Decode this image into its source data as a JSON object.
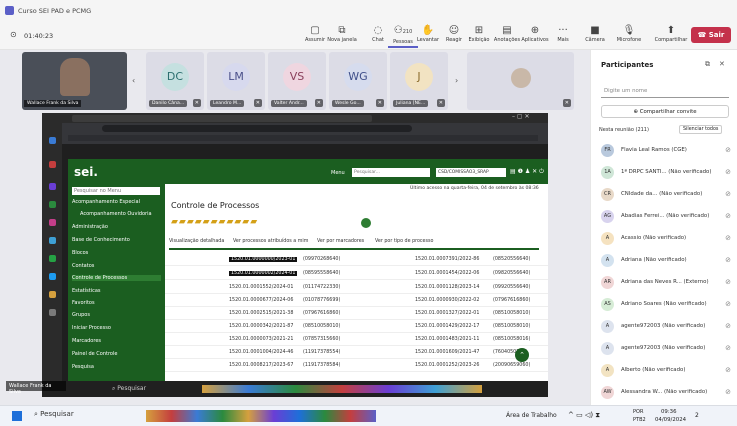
{
  "window": {
    "title": "Curso SEI PAD e PCMG",
    "time": "01:40:23"
  },
  "toolbar": {
    "items": [
      {
        "label": "Assumir",
        "icon": "pen-icon"
      },
      {
        "label": "Nova janela",
        "icon": "window-icon"
      },
      {
        "label": "Chat",
        "icon": "chat-icon"
      },
      {
        "label": "Pessoas",
        "icon": "people-icon",
        "count": "210"
      },
      {
        "label": "Levantar",
        "icon": "hand-icon"
      },
      {
        "label": "Reagir",
        "icon": "smile-icon"
      },
      {
        "label": "Exibição",
        "icon": "grid-icon"
      },
      {
        "label": "Anotações",
        "icon": "notes-icon"
      },
      {
        "label": "Aplicativos",
        "icon": "plus-icon"
      },
      {
        "label": "Mais",
        "icon": "more-icon"
      }
    ],
    "camera": "Câmera",
    "mic": "Microfone",
    "share": "Compartilhar",
    "leave": "Sair"
  },
  "participants_strip": {
    "self_name": "Wallace Frank da Silva",
    "tiles": [
      {
        "initials": "DC",
        "name": "Danilo Câna...",
        "color": "#c5e0e0"
      },
      {
        "initials": "LM",
        "name": "Leandro M...",
        "color": "#d7d9ee"
      },
      {
        "initials": "VS",
        "name": "Valter Andr...",
        "color": "#efd6e0"
      },
      {
        "initials": "WG",
        "name": "Wesle Go...",
        "color": "#d6dcee"
      },
      {
        "initials": "J",
        "name": "Juliana [NE...",
        "color": "#f2e3c2"
      }
    ]
  },
  "sei": {
    "logo": "sei.",
    "menu": "Menu",
    "search_placeholder": "Pesquisar...",
    "unit": "CSD/COMISSÃO3_SRAP",
    "last_access": "Último acesso na quarta-feira, 04 de setembro às 08:36",
    "title": "Controle de Processos",
    "links": [
      "Visualização detalhada",
      "Ver processos atribuídos a mim",
      "Ver por marcadores",
      "Ver por tipo de processo"
    ],
    "left_menu": [
      "Pesquisar no Menu",
      "Acompanhamento Especial",
      "Acompanhamento Ouvidoria",
      "Administração",
      "Base de Conhecimento",
      "Blocos",
      "Contatos",
      "Controle de Processos",
      "Estatísticas",
      "Favoritos",
      "Grupos",
      "Iniciar Processo",
      "Marcadores",
      "Painel de Controle",
      "Pesquisa"
    ],
    "rows_left": [
      "1520.01.0000000/2023-01",
      "1520.01.0000002/2024-01",
      "1520.01.0001552/2024-01",
      "1520.01.0000677/2024-06",
      "1520.01.0002515/2021-38",
      "1520.01.0000342/2021-87",
      "1520.01.0000073/2021-21",
      "1520.01.0001004/2024-46",
      "1520.01.0008217/2023-67"
    ],
    "rows_left2": [
      "(09970268640)",
      "(08595558640)",
      "(01174722330)",
      "(01078776699)",
      "(07967616860)",
      "(08510058010)",
      "(07857315660)",
      "(11917378554)",
      "(11917378584)"
    ],
    "rows_right": [
      "1520.01.0007391/2022-86",
      "1520.01.0001454/2022-06",
      "1520.01.0001128/2023-14",
      "1520.01.0000930/2022-02",
      "1520.01.0001327/2022-01",
      "1520.01.0001429/2022-17",
      "1520.01.0001483/2021-11",
      "1520.01.0001609/2021-47",
      "1520.01.0001252/2023-26"
    ],
    "rows_right2": [
      "(08520556640)",
      "(09820556640)",
      "(09920556640)",
      "(07967616860)",
      "(08510058010)",
      "(08510058010)",
      "(08510058016)",
      "(7604050710)",
      "(20090659060)"
    ]
  },
  "panel": {
    "title": "Participantes",
    "search_placeholder": "Digite um nome",
    "share_invite": "Compartilhar convite",
    "section": "Nesta reunião (211)",
    "mute_all": "Silenciar todos",
    "people": [
      {
        "initials": "FR",
        "name": "Flavia Leal Ramos (CGE)",
        "color": "#b9c9dd"
      },
      {
        "initials": "1A",
        "name": "1ª DRPC SANTI... (Não verificado)",
        "color": "#cfe6d7"
      },
      {
        "initials": "CR",
        "name": "CNIdade da... (Não verificado)",
        "color": "#e8d9c8"
      },
      {
        "initials": "AG",
        "name": "Abadias Ferrei... (Não verificado)",
        "color": "#d8d3ee"
      },
      {
        "initials": "A",
        "name": "Acassio (Não verificado)",
        "color": "#f5e2c0"
      },
      {
        "initials": "A",
        "name": "Adriana (Não verificado)",
        "color": "#d3e2ef"
      },
      {
        "initials": "AR",
        "name": "Adriana das Neves R... (Externo)",
        "color": "#f0d6d6"
      },
      {
        "initials": "AS",
        "name": "Adriano Soares (Não verificado)",
        "color": "#d6ecd6"
      },
      {
        "initials": "A",
        "name": "agente972003 (Não verificado)",
        "color": "#dde3ee"
      },
      {
        "initials": "A",
        "name": "agente972003 (Não verificado)",
        "color": "#dde3ee"
      },
      {
        "initials": "A",
        "name": "Alberto (Não verificado)",
        "color": "#f2e3c2"
      },
      {
        "initials": "AW",
        "name": "Alessandra W... (Não verificado)",
        "color": "#f0d6d6"
      }
    ]
  },
  "taskbar": {
    "search": "Pesquisar",
    "work_area": "Área de Trabalho",
    "lang": "POR",
    "layout": "PTB2",
    "time": "09:36",
    "date": "04/09/2024",
    "notif": "2"
  }
}
